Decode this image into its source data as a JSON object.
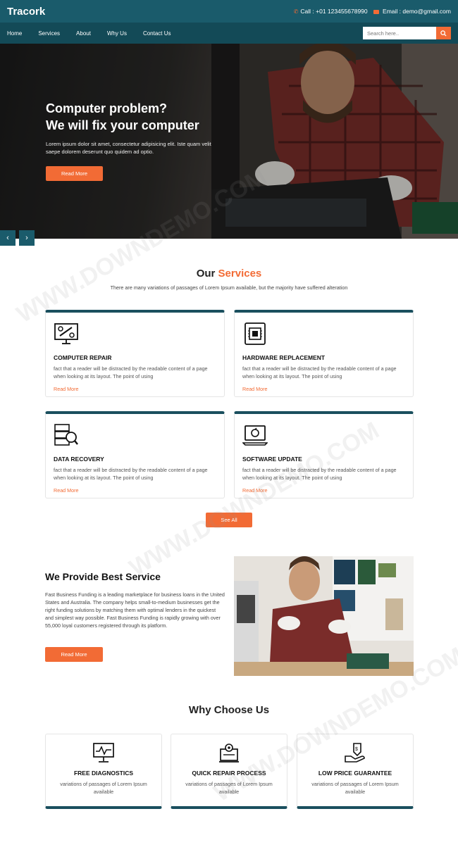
{
  "brand": "Tracork",
  "contact": {
    "phone": "Call : +01 123455678990",
    "email": "Email : demo@gmail.com"
  },
  "nav": [
    "Home",
    "Services",
    "About",
    "Why Us",
    "Contact Us"
  ],
  "search": {
    "placeholder": "Search here.."
  },
  "hero": {
    "title_line1": "Computer problem?",
    "title_line2": "We will fix your computer",
    "description": "Lorem ipsum dolor sit amet, consectetur adipisicing elit. Iste quam velit saepe dolorem deserunt quo quidem ad optio.",
    "button": "Read More",
    "prev": "‹",
    "next": "›"
  },
  "services": {
    "title_plain": "Our ",
    "title_accent": "Services",
    "subtitle": "There are many variations of passages of Lorem Ipsum available, but the majority have suffered alteration",
    "cards": [
      {
        "icon": "computer-repair-icon",
        "title": "COMPUTER REPAIR",
        "text": "fact that a reader will be distracted by the readable content of a page when looking at its layout. The point of using",
        "link": "Read More"
      },
      {
        "icon": "hardware-chip-icon",
        "title": "HARDWARE REPLACEMENT",
        "text": "fact that a reader will be distracted by the readable content of a page when looking at its layout. The point of using",
        "link": "Read More"
      },
      {
        "icon": "data-recovery-icon",
        "title": "DATA RECOVERY",
        "text": "fact that a reader will be distracted by the readable content of a page when looking at its layout. The point of using",
        "link": "Read More"
      },
      {
        "icon": "software-update-icon",
        "title": "SOFTWARE UPDATE",
        "text": "fact that a reader will be distracted by the readable content of a page when looking at its layout. The point of using",
        "link": "Read More"
      }
    ],
    "see_all": "See All"
  },
  "provide": {
    "title": "We Provide Best Service",
    "text": "Fast Business Funding is a leading marketplace for business loans in the United States and Australia. The company helps small-to-medium businesses get the right funding solutions by matching them with optimal lenders in the quickest and simplest way possible. Fast Business Funding is rapidly growing with over 55,000 loyal customers registered through its platform.",
    "button": "Read More"
  },
  "why": {
    "title": "Why Choose Us",
    "cards": [
      {
        "icon": "diagnostics-monitor-icon",
        "title": "FREE DIAGNOSTICS",
        "text": "variations of passages of Lorem Ipsum available"
      },
      {
        "icon": "repair-process-icon",
        "title": "QUICK REPAIR PROCESS",
        "text": "variations of passages of Lorem Ipsum available"
      },
      {
        "icon": "price-guarantee-icon",
        "title": "LOW PRICE GUARANTEE",
        "text": "variations of passages of Lorem Ipsum available"
      }
    ]
  },
  "watermark": "WWW.DOWNDEMO.COM",
  "colors": {
    "primary": "#1a5b6b",
    "nav": "#134a57",
    "accent": "#f26b35"
  }
}
